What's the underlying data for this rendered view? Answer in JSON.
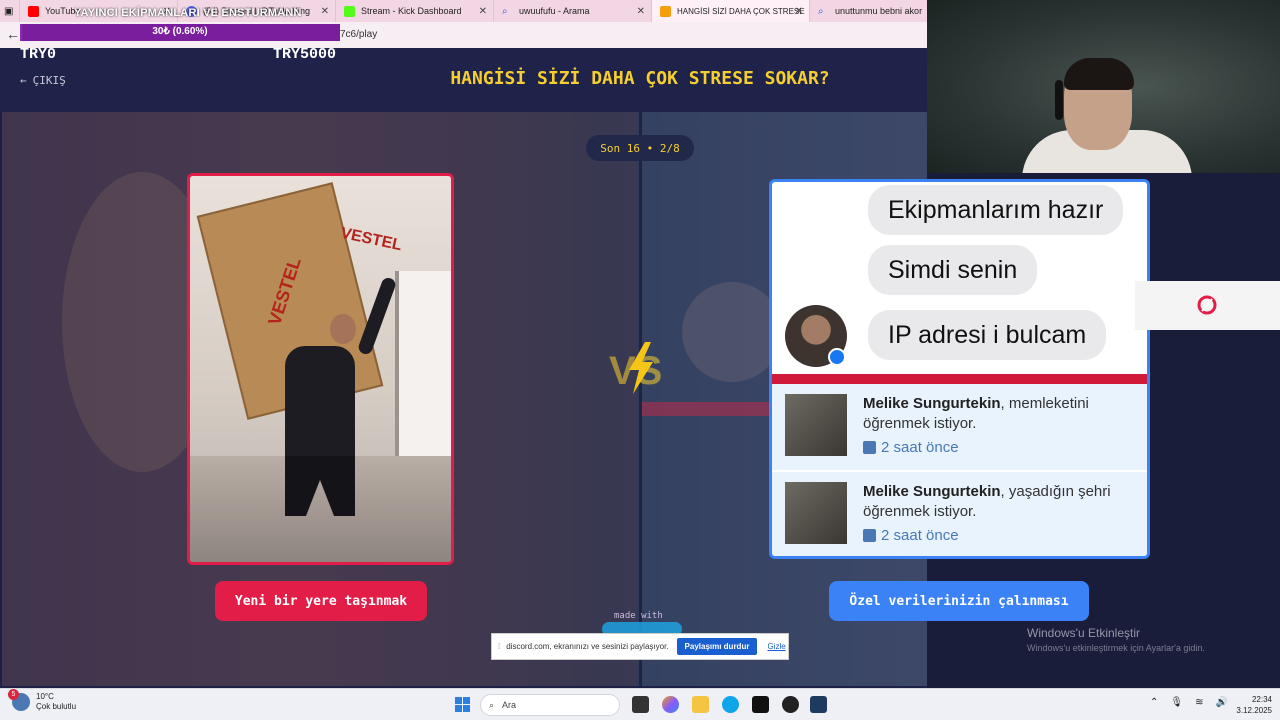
{
  "browser": {
    "tabs": [
      {
        "label": "YouTube",
        "icon": "youtube-icon",
        "color": "#ff0000"
      },
      {
        "label": "(54) Discord | @Takla King",
        "icon": "discord-icon",
        "color": "#5865f2"
      },
      {
        "label": "Stream - Kick Dashboard",
        "icon": "kick-icon",
        "color": "#53fc18"
      },
      {
        "label": "uwuufufu - Arama",
        "icon": "search-icon",
        "color": "#2563eb"
      },
      {
        "label": "HANGİSİ SİZİ DAHA ÇOK STRESE",
        "icon": "game-icon",
        "color": "#f59e0b"
      },
      {
        "label": "unuttunmu bebni akor",
        "icon": "search-icon",
        "color": "#2563eb"
      }
    ],
    "url": "7c6/play"
  },
  "overlay": {
    "title": "YAYINCI EKİPMANLARI VE ENSTURMANN",
    "progress_text": "30₺ (0.60%)",
    "progress_fraction": 0.006
  },
  "header": {
    "try_left": "TRY0",
    "try_right": "TRY5000",
    "exit_label": "ÇIKIŞ",
    "title": "HANGİSİ SİZİ DAHA ÇOK STRESE SOKAR?"
  },
  "round": {
    "label": "Son 16 • 2/8"
  },
  "left_option": {
    "label": "Yeni bir yere taşınmak",
    "box_text_1": "VESTEL",
    "box_text_2": "VESTEL",
    "accent": "#e11d48"
  },
  "right_option": {
    "label": "Özel verilerinizin çalınması",
    "accent": "#3b82f6",
    "bubbles": [
      "Ekipmanlarım hazır",
      "Simdi senin",
      "IP adresi i bulcam"
    ],
    "notifications": [
      {
        "name": "Melike Sungurtekin",
        "text": ", memleketini öğrenmek istiyor.",
        "time": "2 saat önce"
      },
      {
        "name": "Melike Sungurtekin",
        "text": ", yaşadığın şehri öğrenmek istiyor.",
        "time": "2 saat önce"
      }
    ]
  },
  "made_with": "made with",
  "share_bar": {
    "text": "discord.com, ekranınızı ve sesinizi paylaşıyor.",
    "stop_label": "Paylaşımı durdur",
    "hide_label": "Gizle"
  },
  "watermark": {
    "line1": "Windows'u Etkinleştir",
    "line2": "Windows'u etkinleştirmek için Ayarlar'a gidin."
  },
  "taskbar": {
    "weather_temp": "10°C",
    "weather_desc": "Çok bulutlu",
    "weather_badge": "5",
    "search_placeholder": "Ara",
    "time": "22:34",
    "date": "3.12.2025"
  }
}
